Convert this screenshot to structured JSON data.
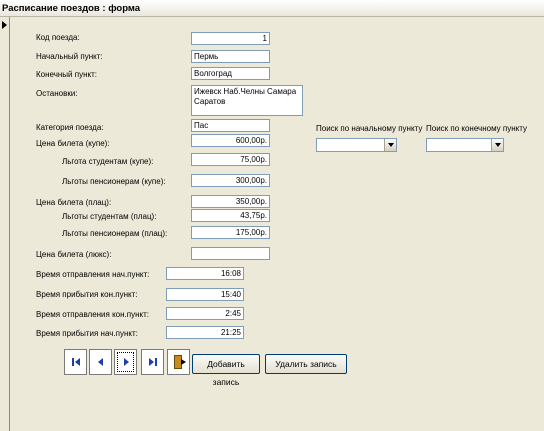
{
  "window": {
    "title": "Расписание поездов : форма"
  },
  "fields": {
    "train_code": {
      "label": "Код поезда:",
      "value": "1"
    },
    "start_point": {
      "label": "Начальный пункт:",
      "value": "Пермь"
    },
    "end_point": {
      "label": "Конечный пункт:",
      "value": "Волгоград"
    },
    "stops": {
      "label": "Остановки:",
      "value_line1": "Ижевск Наб.Челны Самара",
      "value_line2": "Саратов"
    },
    "category": {
      "label": "Категория поезда:",
      "value": "Пас"
    },
    "price_coupe": {
      "label": "Цена билета (купе):",
      "value": "600,00р."
    },
    "discount_students_coupe": {
      "label": "Льгота студентам (купе):",
      "value": "75,00р."
    },
    "discount_pensioners_coupe": {
      "label": "Льготы пенсионерам (купе):",
      "value": "300,00р."
    },
    "price_platz": {
      "label": "Цена билета (плац):",
      "value": "350,00р."
    },
    "discount_students_platz": {
      "label": "Льготы студентам (плац):",
      "value": "43,75р."
    },
    "discount_pensioners_platz": {
      "label": "Льготы пенсионерам (плац):",
      "value": "175,00р."
    },
    "price_lux": {
      "label": "Цена билета (люкс):",
      "value": ""
    },
    "depart_start": {
      "label": "Время отправления нач.пункт:",
      "value": "16:08"
    },
    "arrive_end": {
      "label": "Время прибытия кон.пункт:",
      "value": "15:40"
    },
    "depart_end": {
      "label": "Время отправления кон.пункт:",
      "value": "2:45"
    },
    "arrive_start": {
      "label": "Время прибытия нач.пункт:",
      "value": "21:25"
    }
  },
  "search": {
    "by_start_label": "Поиск по начальному пункту",
    "by_end_label": "Поиск по конечному пункту",
    "by_start_value": "",
    "by_end_value": ""
  },
  "buttons": {
    "add": "Добавить запись",
    "delete": "Удалить запись"
  },
  "colors": {
    "nav_arrow": "#1d3fa6",
    "field_border": "#7f9db9",
    "background": "#ece9d8"
  }
}
